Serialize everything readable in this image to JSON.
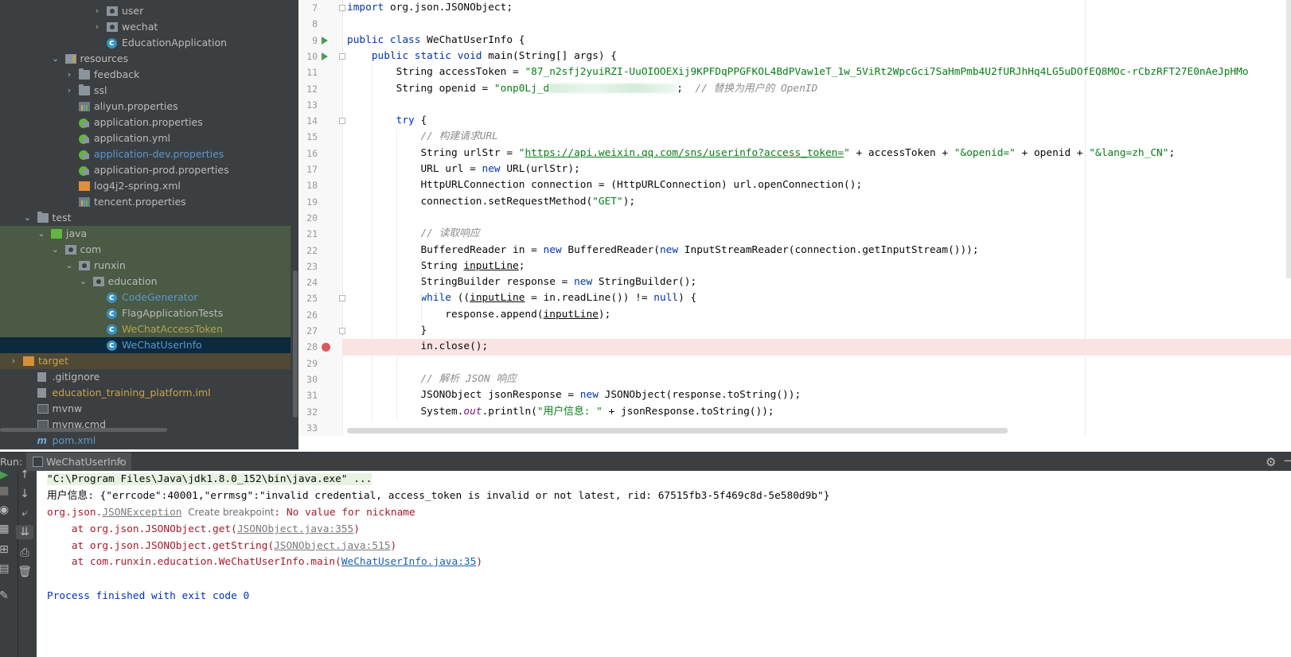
{
  "project_tree": {
    "items": [
      {
        "label": "user",
        "type": "package",
        "depth": 6,
        "expanded": false
      },
      {
        "label": "wechat",
        "type": "package",
        "depth": 6,
        "expanded": false
      },
      {
        "label": "EducationApplication",
        "type": "spring-class",
        "depth": 6
      },
      {
        "label": "resources",
        "type": "resources-folder",
        "depth": 3,
        "expanded": true
      },
      {
        "label": "feedback",
        "type": "folder",
        "depth": 4,
        "expanded": false
      },
      {
        "label": "ssl",
        "type": "folder",
        "depth": 4,
        "expanded": false
      },
      {
        "label": "aliyun.properties",
        "type": "properties",
        "depth": 4
      },
      {
        "label": "application.properties",
        "type": "spring-config",
        "depth": 4
      },
      {
        "label": "application.yml",
        "type": "spring-config",
        "depth": 4
      },
      {
        "label": "application-dev.properties",
        "type": "spring-config",
        "depth": 4,
        "color": "blue"
      },
      {
        "label": "application-prod.properties",
        "type": "spring-config",
        "depth": 4
      },
      {
        "label": "log4j2-spring.xml",
        "type": "xml",
        "depth": 4
      },
      {
        "label": "tencent.properties",
        "type": "properties",
        "depth": 4
      },
      {
        "label": "test",
        "type": "folder",
        "depth": 1,
        "expanded": true
      },
      {
        "label": "java",
        "type": "test-folder",
        "depth": 2,
        "expanded": true,
        "highlight": "test"
      },
      {
        "label": "com",
        "type": "package",
        "depth": 3,
        "expanded": true,
        "highlight": "test"
      },
      {
        "label": "runxin",
        "type": "package",
        "depth": 4,
        "expanded": true,
        "highlight": "test"
      },
      {
        "label": "education",
        "type": "package",
        "depth": 5,
        "expanded": true,
        "highlight": "test"
      },
      {
        "label": "CodeGenerator",
        "type": "class",
        "depth": 6,
        "color": "blue",
        "highlight": "test"
      },
      {
        "label": "FlagApplicationTests",
        "type": "class",
        "depth": 6,
        "highlight": "test"
      },
      {
        "label": "WeChatAccessToken",
        "type": "class",
        "depth": 6,
        "color": "olive",
        "highlight": "test"
      },
      {
        "label": "WeChatUserInfo",
        "type": "class",
        "depth": 6,
        "color": "blue",
        "highlight": "selected"
      },
      {
        "label": "target",
        "type": "target-folder",
        "depth": 0,
        "expanded": false,
        "color": "yellow",
        "highlight": "target"
      },
      {
        "label": ".gitignore",
        "type": "file",
        "depth": 1
      },
      {
        "label": "education_training_platform.iml",
        "type": "file",
        "depth": 1,
        "color": "yellow"
      },
      {
        "label": "mvnw",
        "type": "terminal",
        "depth": 1
      },
      {
        "label": "mvnw.cmd",
        "type": "terminal",
        "depth": 1
      },
      {
        "label": "pom.xml",
        "type": "maven",
        "depth": 1,
        "color": "blue"
      }
    ]
  },
  "editor": {
    "line_numbers": [
      "7",
      "8",
      "9",
      "10",
      "11",
      "12",
      "13",
      "14",
      "15",
      "16",
      "17",
      "18",
      "19",
      "20",
      "21",
      "22",
      "23",
      "24",
      "25",
      "26",
      "27",
      "28",
      "29",
      "30",
      "31",
      "32",
      "33"
    ],
    "run_marker_lines": [
      "9",
      "10"
    ],
    "breakpoint_line": "28",
    "lines": [
      {
        "segs": [
          {
            "t": "import",
            "c": "kw"
          },
          {
            "t": " org.json.JSONObject;"
          }
        ]
      },
      {
        "segs": []
      },
      {
        "segs": [
          {
            "t": "public class",
            "c": "kw"
          },
          {
            "t": " WeChatUserInfo {"
          }
        ]
      },
      {
        "segs": [
          {
            "t": "    "
          },
          {
            "t": "public static void",
            "c": "kw"
          },
          {
            "t": " main(String[] args) {"
          }
        ]
      },
      {
        "segs": [
          {
            "t": "        String accessToken = "
          },
          {
            "t": "\"87_n2sfj2yuiRZI-UuOIOOEXij9KPFDqPPGFKOL4BdPVaw1eT_1w_5ViRt2WpcGci7SaHmPmb4U2fURJhHq4LG5uDOfEQ8MOc-rCbzRFT27E0nAeJpHMo",
            "c": "str"
          }
        ]
      },
      {
        "segs": [
          {
            "t": "        String openid = "
          },
          {
            "t": "\"onp0Lj_d",
            "c": "str"
          },
          {
            "blur": true
          },
          {
            "t": ";  "
          },
          {
            "t": "// 替换为用户的 OpenID",
            "c": "cmt"
          }
        ]
      },
      {
        "segs": []
      },
      {
        "segs": [
          {
            "t": "        "
          },
          {
            "t": "try",
            "c": "kw"
          },
          {
            "t": " {"
          }
        ]
      },
      {
        "segs": [
          {
            "t": "            "
          },
          {
            "t": "// 构建请求URL",
            "c": "cmt"
          }
        ]
      },
      {
        "segs": [
          {
            "t": "            String urlStr = "
          },
          {
            "t": "\"",
            "c": "str"
          },
          {
            "t": "https://api.weixin.qq.com/sns/userinfo?access_token=",
            "c": "str u"
          },
          {
            "t": "\"",
            "c": "str"
          },
          {
            "t": " + accessToken + "
          },
          {
            "t": "\"&openid=\"",
            "c": "str"
          },
          {
            "t": " + openid + "
          },
          {
            "t": "\"&lang=zh_CN\"",
            "c": "str"
          },
          {
            "t": ";"
          }
        ]
      },
      {
        "segs": [
          {
            "t": "            URL url = "
          },
          {
            "t": "new",
            "c": "kw"
          },
          {
            "t": " URL(urlStr);"
          }
        ]
      },
      {
        "segs": [
          {
            "t": "            HttpURLConnection connection = (HttpURLConnection) url.openConnection();"
          }
        ]
      },
      {
        "segs": [
          {
            "t": "            connection.setRequestMethod("
          },
          {
            "t": "\"GET\"",
            "c": "str"
          },
          {
            "t": ");"
          }
        ]
      },
      {
        "segs": []
      },
      {
        "segs": [
          {
            "t": "            "
          },
          {
            "t": "// 读取响应",
            "c": "cmt"
          }
        ]
      },
      {
        "segs": [
          {
            "t": "            BufferedReader in = "
          },
          {
            "t": "new",
            "c": "kw"
          },
          {
            "t": " BufferedReader("
          },
          {
            "t": "new",
            "c": "kw"
          },
          {
            "t": " InputStreamReader(connection.getInputStream()));"
          }
        ]
      },
      {
        "segs": [
          {
            "t": "            String "
          },
          {
            "t": "inputLine",
            "c": "u"
          },
          {
            "t": ";"
          }
        ]
      },
      {
        "segs": [
          {
            "t": "            StringBuilder response = "
          },
          {
            "t": "new",
            "c": "kw"
          },
          {
            "t": " StringBuilder();"
          }
        ]
      },
      {
        "segs": [
          {
            "t": "            "
          },
          {
            "t": "while",
            "c": "kw"
          },
          {
            "t": " (("
          },
          {
            "t": "inputLine",
            "c": "u"
          },
          {
            "t": " = in.readLine()) != "
          },
          {
            "t": "null",
            "c": "kw"
          },
          {
            "t": ") {"
          }
        ]
      },
      {
        "segs": [
          {
            "t": "                response.append("
          },
          {
            "t": "inputLine",
            "c": "u"
          },
          {
            "t": ");"
          }
        ]
      },
      {
        "segs": [
          {
            "t": "            }"
          }
        ]
      },
      {
        "segs": [
          {
            "t": "            in.close();"
          }
        ]
      },
      {
        "segs": []
      },
      {
        "segs": [
          {
            "t": "            "
          },
          {
            "t": "// 解析 JSON 响应",
            "c": "cmt"
          }
        ]
      },
      {
        "segs": [
          {
            "t": "            JSONObject jsonResponse = "
          },
          {
            "t": "new",
            "c": "kw"
          },
          {
            "t": " JSONObject(response.toString());"
          }
        ]
      },
      {
        "segs": [
          {
            "t": "            System."
          },
          {
            "t": "out",
            "c": "fld"
          },
          {
            "t": ".println("
          },
          {
            "t": "\"用户信息: \"",
            "c": "str"
          },
          {
            "t": " + jsonResponse.toString());"
          }
        ]
      },
      {
        "segs": []
      }
    ]
  },
  "run_window": {
    "label": "Run:",
    "tab_label": "WeChatUserInfo",
    "tab_close": "×",
    "gear_icon": "⚙",
    "minimize_icon": "−",
    "console": {
      "command": "\"C:\\Program Files\\Java\\jdk1.8.0_152\\bin\\java.exe\" ...",
      "output": "用户信息: {\"errcode\":40001,\"errmsg\":\"invalid credential, access_token is invalid or not latest, rid: 67515fb3-5f469c8d-5e580d9b\"}",
      "exception_prefix": "org.json.",
      "exception_class": "JSONException",
      "create_breakpoint": "Create breakpoint",
      "exception_message": ": No value for nickname",
      "stack": [
        {
          "prefix": "    at org.json.JSONObject.get(",
          "link": "JSONObject.java:355",
          "link_style": "grey",
          "suffix": ")"
        },
        {
          "prefix": "    at org.json.JSONObject.getString(",
          "link": "JSONObject.java:515",
          "link_style": "grey",
          "suffix": ")"
        },
        {
          "prefix": "    at com.runxin.education.WeChatUserInfo.main(",
          "link": "WeChatUserInfo.java:35",
          "link_style": "blue",
          "suffix": ")"
        }
      ],
      "exit": "Process finished with exit code 0"
    }
  },
  "colors": {
    "tree_bg": "#3c3f41",
    "keyword": "#0033b3",
    "string": "#067d17",
    "comment": "#8c8c8c",
    "error": "#a8192b",
    "breakpoint": "#db5860",
    "run_marker": "#499c54"
  }
}
